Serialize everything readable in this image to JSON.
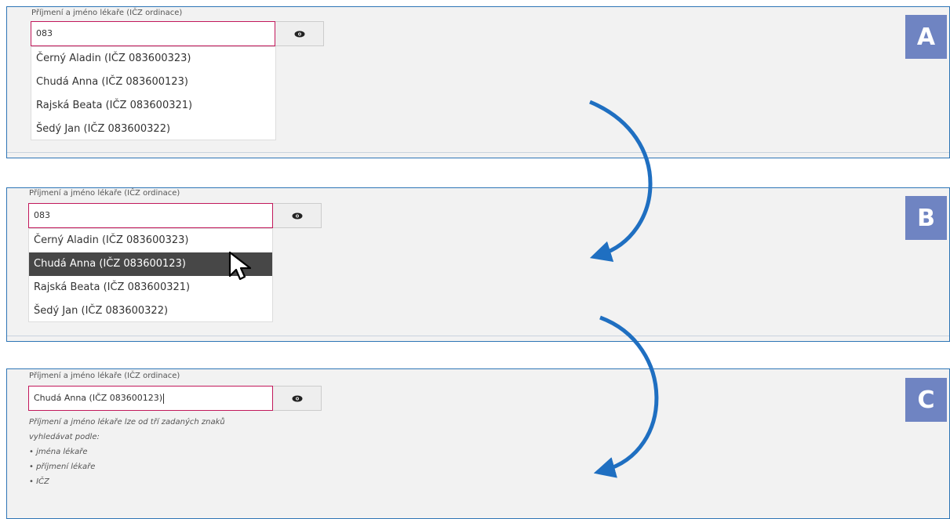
{
  "field_label": "Příjmení a jméno lékaře (IČZ ordinace)",
  "search_value": "083",
  "selected_value": "Chudá Anna (IČZ 083600123)",
  "results": [
    "Černý Aladin (IČZ 083600323)",
    "Chudá Anna (IČZ 083600123)",
    "Rajská Beata (IČZ 083600321)",
    "Šedý Jan (IČZ 083600322)"
  ],
  "active_result_index": 1,
  "steps": [
    "A",
    "B",
    "C"
  ],
  "hint_lines": [
    "Příjmení a jméno lékaře lze od tří zadaných znaků",
    "vyhledávat podle:",
    "• jména lékaře",
    "• příjmení lékaře",
    "• IČZ"
  ],
  "colors": {
    "panel_border": "#2e75b6",
    "input_border": "#c2185b",
    "badge": "#6f84c2",
    "arrow": "#1f6fc1",
    "active_row": "#474747"
  },
  "icons": {
    "toggle": "eye-icon",
    "pointer": "mouse-cursor-icon",
    "transition": "curved-arrow-icon"
  }
}
